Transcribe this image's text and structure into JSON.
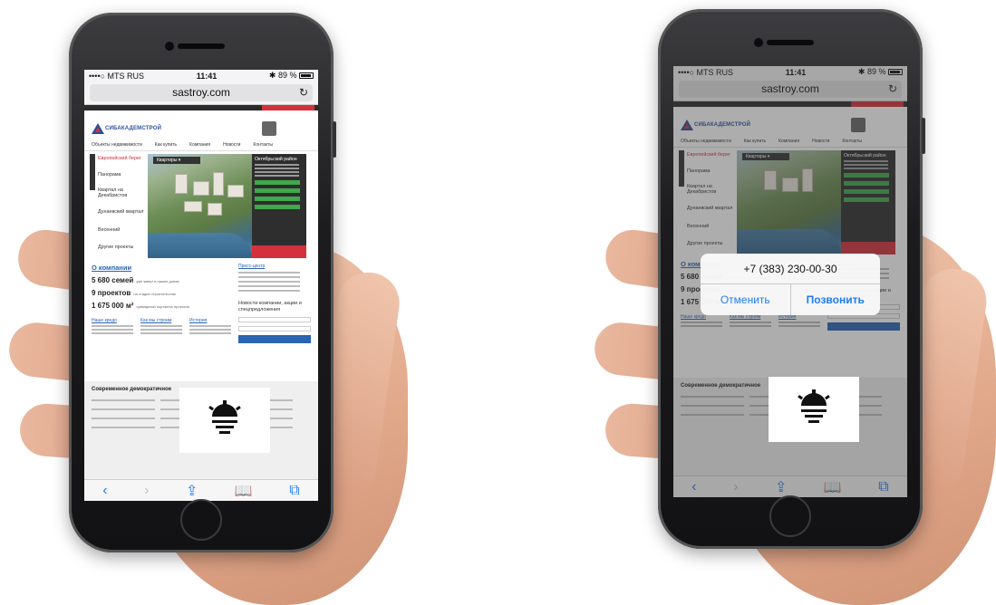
{
  "phones": [
    {
      "status": {
        "carrier": "••••○ MTS RUS",
        "time": "11:41",
        "battery": "89 %"
      },
      "url": "sastroy.com",
      "site": {
        "logo": "СИБАКАДЕМСТРОЙ",
        "nav": [
          "Объекты недвижимости",
          "Как купить",
          "Компания",
          "Новости",
          "Контакты"
        ],
        "side_menu": [
          {
            "label": "Европейский берег",
            "active": true
          },
          {
            "label": "Панорама",
            "active": false
          },
          {
            "label": "Квартал на Декабристов",
            "active": false
          },
          {
            "label": "Дунаевский квартал",
            "active": false
          },
          {
            "label": "Весенний",
            "active": false
          },
          {
            "label": "Другие проекты",
            "active": false
          }
        ],
        "dropdown": "Квартиры ▾",
        "promo_title": "Октябрьский район",
        "about_title": "О компании",
        "facts": [
          {
            "value": "5 680 семей",
            "caption": "уже живут в наших домах"
          },
          {
            "value": "9 проектов",
            "caption": "на стадии строительства"
          },
          {
            "value": "1 675 000 м²",
            "caption": "суммарный портфель проектов"
          }
        ],
        "about_links": [
          "Наше кредо",
          "Как мы строим",
          "История"
        ],
        "press_title": "Пресс-центр",
        "news_title": "Новости компании, акции и спецпредложения",
        "demo_title": "Современное демократичное"
      }
    },
    {
      "status": {
        "carrier": "••••○ MTS RUS",
        "time": "11:41",
        "battery": "89 %"
      },
      "url": "sastroy.com",
      "alert": {
        "phone_number": "+7 (383) 230-00-30",
        "cancel": "Отменить",
        "call": "Позвонить"
      }
    }
  ],
  "toolbar_icons": [
    "back-icon",
    "forward-icon",
    "share-icon",
    "bookmarks-icon",
    "tabs-icon"
  ],
  "colors": {
    "brand_blue": "#2a4f9b",
    "brand_red": "#d3313b",
    "ios_blue": "#1f7cf6"
  }
}
